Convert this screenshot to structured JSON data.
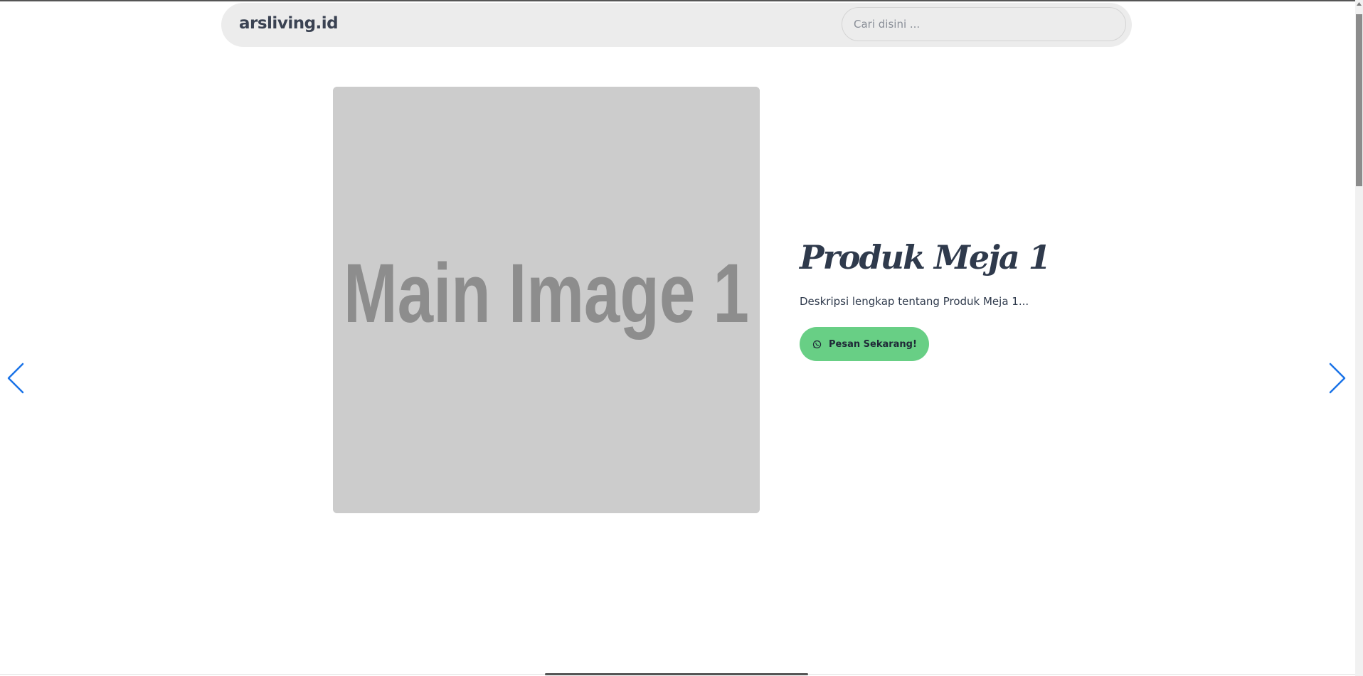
{
  "navbar": {
    "brand": "arsliving.id",
    "search_placeholder": "Cari disini ..."
  },
  "slide": {
    "image_label": "Main Image 1",
    "title": "Produk Meja 1",
    "description": "Deskripsi lengkap tentang Produk Meja 1...",
    "order_button_label": "Pesan Sekarang!"
  },
  "colors": {
    "accent_green": "#68cf85",
    "arrow_blue": "#1a73e8",
    "placeholder_bg": "#cccccc"
  },
  "icons": {
    "order_button": "whatsapp-icon",
    "prev": "chevron-left-icon",
    "next": "chevron-right-icon"
  }
}
